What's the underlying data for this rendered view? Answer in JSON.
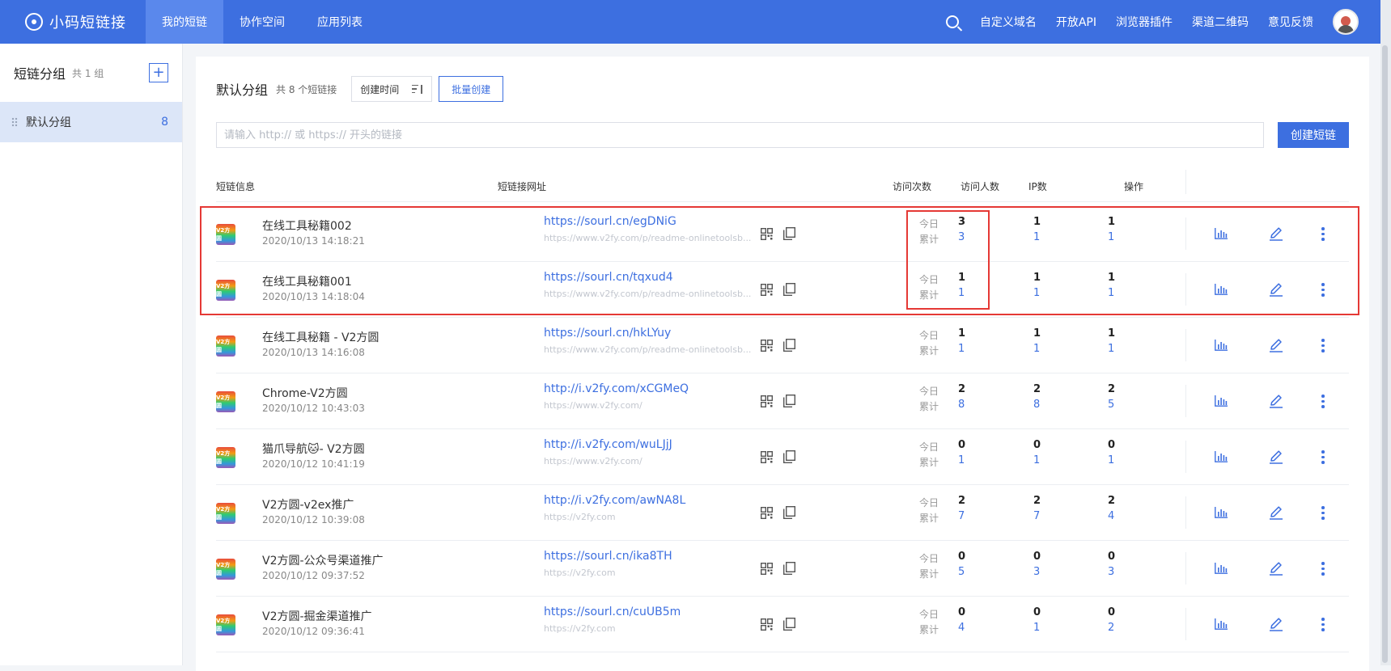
{
  "header": {
    "brand": "小码短链接",
    "nav": [
      {
        "label": "我的短链",
        "active": true
      },
      {
        "label": "协作空间",
        "active": false
      },
      {
        "label": "应用列表",
        "active": false
      }
    ],
    "links": [
      "自定义域名",
      "开放API",
      "浏览器插件",
      "渠道二维码",
      "意见反馈"
    ]
  },
  "sidebar": {
    "title": "短链分组",
    "count_text": "共 1 组",
    "add_label": "+",
    "groups": [
      {
        "label": "默认分组",
        "count": "8"
      }
    ]
  },
  "main": {
    "title": "默认分组",
    "subtitle": "共 8 个短链接",
    "sort_label": "创建时间",
    "batch_label": "批量创建",
    "input_placeholder": "请输入 http:// 或 https:// 开头的链接",
    "create_label": "创建短链",
    "columns": {
      "info": "短链信息",
      "url": "短链接网址",
      "visits": "访问次数",
      "visitors": "访问人数",
      "ip": "IP数",
      "actions": "操作"
    },
    "today_label": "今日",
    "total_label": "累计",
    "logo_text": "V2方圆"
  },
  "links": [
    {
      "name": "在线工具秘籍002",
      "time": "2020/10/13 14:18:21",
      "short": "https://sourl.cn/egDNiG",
      "long": "https://www.v2fy.com/p/readme-onlinetoolsb...",
      "visits": {
        "today": "3",
        "total": "3"
      },
      "visitors": {
        "today": "1",
        "total": "1"
      },
      "ip": {
        "today": "1",
        "total": "1"
      }
    },
    {
      "name": "在线工具秘籍001",
      "time": "2020/10/13 14:18:04",
      "short": "https://sourl.cn/tqxud4",
      "long": "https://www.v2fy.com/p/readme-onlinetoolsb...",
      "visits": {
        "today": "1",
        "total": "1"
      },
      "visitors": {
        "today": "1",
        "total": "1"
      },
      "ip": {
        "today": "1",
        "total": "1"
      }
    },
    {
      "name": "在线工具秘籍 - V2方圆",
      "time": "2020/10/13 14:16:08",
      "short": "https://sourl.cn/hkLYuy",
      "long": "https://www.v2fy.com/p/readme-onlinetoolsb...",
      "visits": {
        "today": "1",
        "total": "1"
      },
      "visitors": {
        "today": "1",
        "total": "1"
      },
      "ip": {
        "today": "1",
        "total": "1"
      }
    },
    {
      "name": "Chrome-V2方圆",
      "time": "2020/10/12 10:43:03",
      "short": "http://i.v2fy.com/xCGMeQ",
      "long": "https://www.v2fy.com/",
      "visits": {
        "today": "2",
        "total": "8"
      },
      "visitors": {
        "today": "2",
        "total": "8"
      },
      "ip": {
        "today": "2",
        "total": "5"
      }
    },
    {
      "name": "猫爪导航🐱- V2方圆",
      "time": "2020/10/12 10:41:19",
      "short": "http://i.v2fy.com/wuLJjJ",
      "long": "https://www.v2fy.com/",
      "visits": {
        "today": "0",
        "total": "1"
      },
      "visitors": {
        "today": "0",
        "total": "1"
      },
      "ip": {
        "today": "0",
        "total": "1"
      }
    },
    {
      "name": "V2方圆-v2ex推广",
      "time": "2020/10/12 10:39:08",
      "short": "http://i.v2fy.com/awNA8L",
      "long": "https://v2fy.com",
      "visits": {
        "today": "2",
        "total": "7"
      },
      "visitors": {
        "today": "2",
        "total": "7"
      },
      "ip": {
        "today": "2",
        "total": "4"
      }
    },
    {
      "name": "V2方圆-公众号渠道推广",
      "time": "2020/10/12 09:37:52",
      "short": "https://sourl.cn/ika8TH",
      "long": "https://v2fy.com",
      "visits": {
        "today": "0",
        "total": "5"
      },
      "visitors": {
        "today": "0",
        "total": "3"
      },
      "ip": {
        "today": "0",
        "total": "3"
      }
    },
    {
      "name": "V2方圆-掘金渠道推广",
      "time": "2020/10/12 09:36:41",
      "short": "https://sourl.cn/cuUB5m",
      "long": "https://v2fy.com",
      "visits": {
        "today": "0",
        "total": "4"
      },
      "visitors": {
        "today": "0",
        "total": "1"
      },
      "ip": {
        "today": "0",
        "total": "2"
      }
    }
  ],
  "colors": {
    "accent": "#3d6fe0",
    "highlight_box": "#e53935"
  }
}
